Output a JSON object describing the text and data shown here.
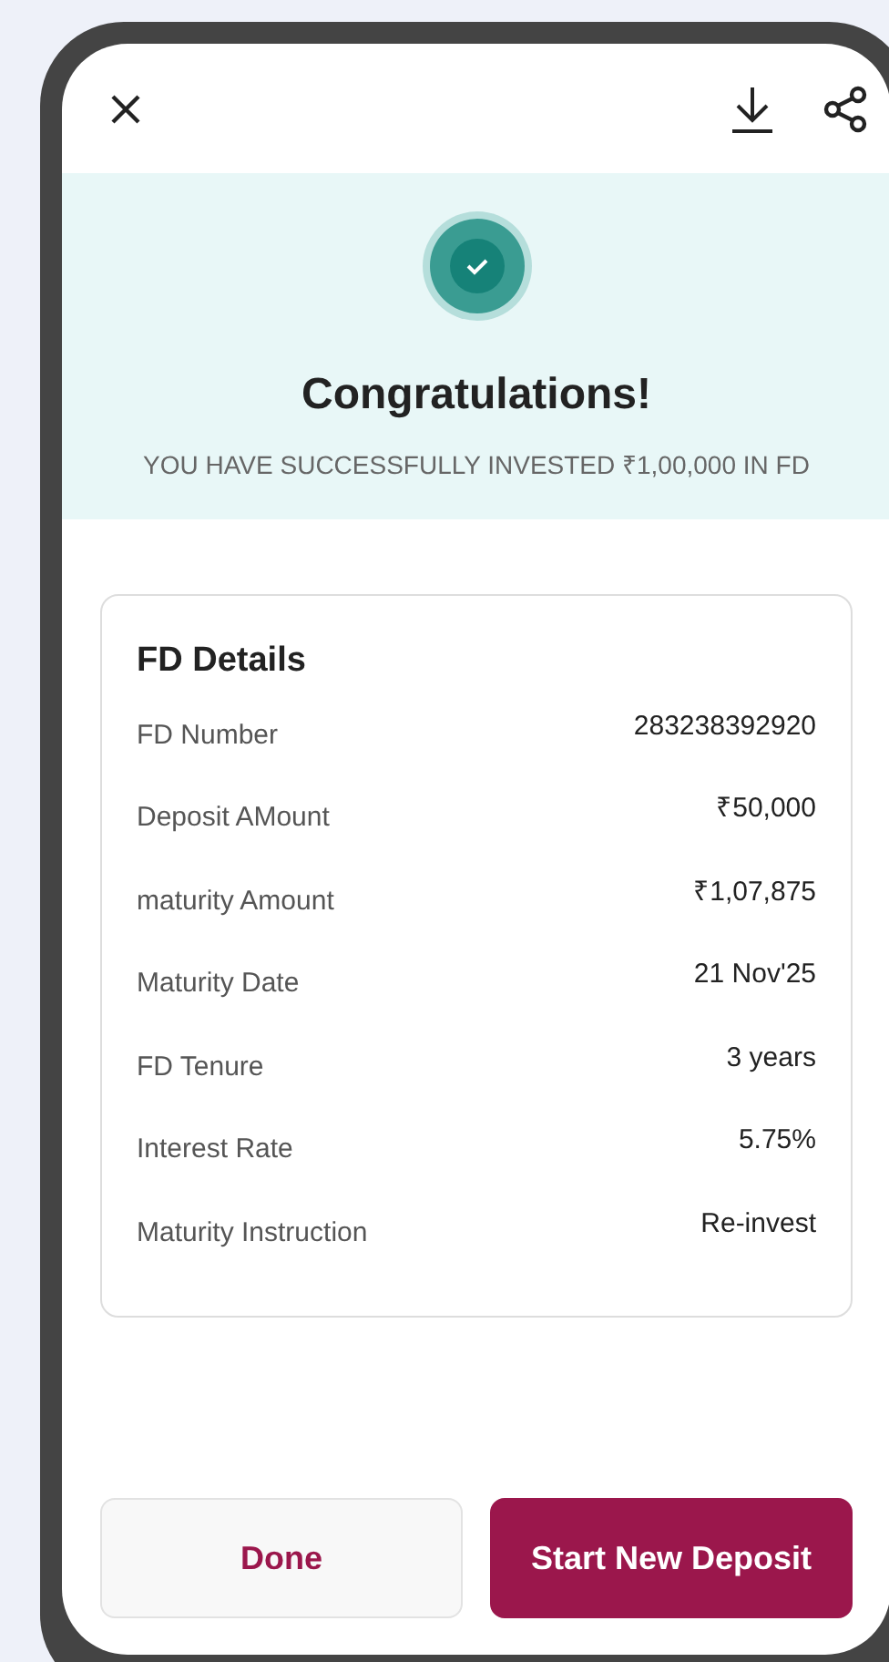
{
  "header": {
    "title": "Congratulations!",
    "subtitle": "YOU HAVE SUCCESSFULLY INVESTED ₹1,00,000 IN FD"
  },
  "details": {
    "title": "FD Details",
    "rows": [
      {
        "label": "FD Number",
        "value": "283238392920"
      },
      {
        "label": "Deposit AMount",
        "value": "₹50,000"
      },
      {
        "label": "maturity Amount",
        "value": "₹1,07,875"
      },
      {
        "label": "Maturity Date",
        "value": "21 Nov'25"
      },
      {
        "label": "FD Tenure",
        "value": "3 years"
      },
      {
        "label": "Interest Rate",
        "value": "5.75%"
      },
      {
        "label": "Maturity Instruction",
        "value": "Re-invest"
      }
    ]
  },
  "buttons": [
    {
      "label": "Done",
      "kind": "secondary"
    },
    {
      "label": "Start New Deposit",
      "kind": "primary"
    }
  ]
}
